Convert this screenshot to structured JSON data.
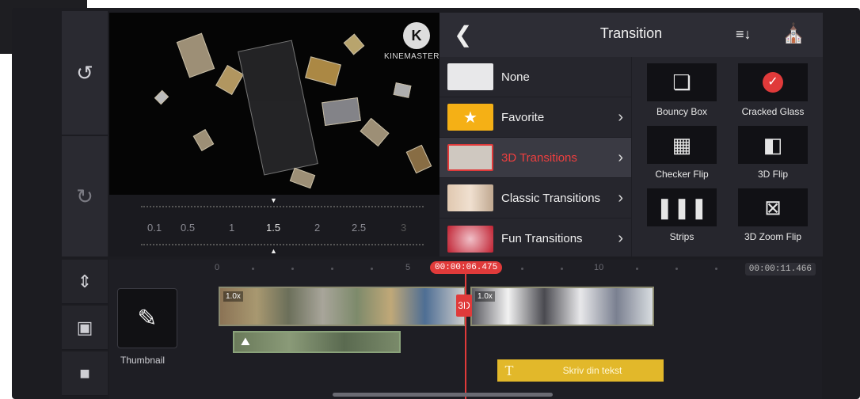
{
  "preview": {
    "logo_letter": "K",
    "logo_text": "KINEMASTER"
  },
  "speed_ruler": {
    "labels": [
      "0.1",
      "0.5",
      "1",
      "1.5",
      "2",
      "2.5",
      "3"
    ],
    "active": "1.5"
  },
  "panel": {
    "title": "Transition",
    "categories": [
      {
        "label": "None",
        "selected": false
      },
      {
        "label": "Favorite",
        "selected": false
      },
      {
        "label": "3D Transitions",
        "selected": true
      },
      {
        "label": "Classic Transitions",
        "selected": false
      },
      {
        "label": "Fun Transitions",
        "selected": false
      }
    ],
    "items": [
      {
        "label": "Bouncy Box",
        "icon": "cube-icon"
      },
      {
        "label": "Cracked Glass",
        "icon": "cracked-glass-icon"
      },
      {
        "label": "Checker Flip",
        "icon": "checker-icon"
      },
      {
        "label": "3D Flip",
        "icon": "flip-icon"
      },
      {
        "label": "Strips",
        "icon": "strips-icon"
      },
      {
        "label": "3D Zoom Flip",
        "icon": "zoom-flip-icon"
      }
    ]
  },
  "timeline": {
    "ticks": [
      "0",
      "5",
      "10"
    ],
    "current_time": "00:00:06.475",
    "end_time": "00:00:11.466",
    "thumbnail_label": "Thumbnail",
    "text_clip_label": "Skriv din tekst",
    "transition_badge": "3D",
    "clip_a_speed": "1.0x",
    "clip_b_speed": "1.0x"
  },
  "colors": {
    "accent": "#e03a3a",
    "text_clip": "#e2b82a",
    "favorite": "#f5b015"
  }
}
